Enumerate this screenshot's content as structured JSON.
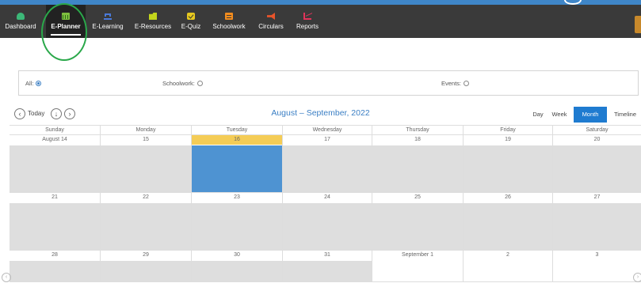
{
  "nav": {
    "items": [
      {
        "label": "Dashboard",
        "icon": "dashboard-icon",
        "active": false
      },
      {
        "label": "E-Planner",
        "icon": "calendar-icon",
        "active": true
      },
      {
        "label": "E-Learning",
        "icon": "laptop-icon",
        "active": false
      },
      {
        "label": "E-Resources",
        "icon": "folder-icon",
        "active": false
      },
      {
        "label": "E-Quiz",
        "icon": "checkbox-icon",
        "active": false
      },
      {
        "label": "Schoolwork",
        "icon": "book-icon",
        "active": false
      },
      {
        "label": "Circulars",
        "icon": "megaphone-icon",
        "active": false
      },
      {
        "label": "Reports",
        "icon": "chart-icon",
        "active": false
      }
    ],
    "highlight_color": "#2aa84a"
  },
  "filters": {
    "all": {
      "label": "All:",
      "selected": true
    },
    "schoolwork": {
      "label": "Schoolwork:",
      "selected": false
    },
    "events": {
      "label": "Events:",
      "selected": false
    }
  },
  "toolbar": {
    "prev_icon": "arrow-left-circle-icon",
    "today_label": "Today",
    "down_icon": "arrow-down-circle-icon",
    "next_icon": "arrow-right-circle-icon",
    "range_title": "August – September, 2022",
    "views": [
      "Day",
      "Week",
      "Month",
      "Timeline"
    ],
    "active_view": "Month"
  },
  "calendar": {
    "weekdays": [
      "Sunday",
      "Monday",
      "Tuesday",
      "Wednesday",
      "Thursday",
      "Friday",
      "Saturday"
    ],
    "weeks": [
      [
        "August 14",
        "15",
        "16",
        "17",
        "18",
        "19",
        "20"
      ],
      [
        "21",
        "22",
        "23",
        "24",
        "25",
        "26",
        "27"
      ],
      [
        "28",
        "29",
        "30",
        "31",
        "September 1",
        "2",
        "3"
      ]
    ],
    "today": "16",
    "selected_color": "#4e93d2",
    "today_color": "#f4cc56"
  },
  "colors": {
    "navbar": "#3a3a3a",
    "accent": "#1f7bd0",
    "topbar": "#3f86c8"
  }
}
